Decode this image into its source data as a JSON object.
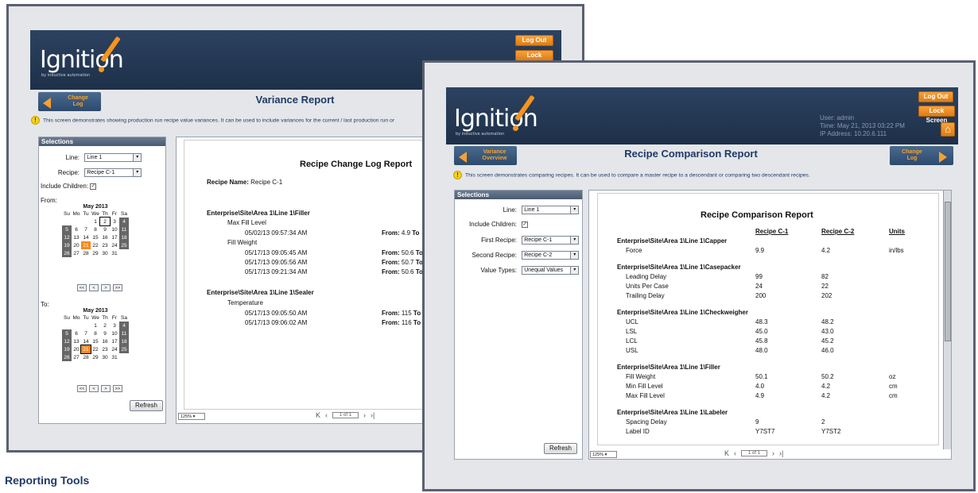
{
  "back": {
    "logo": "Ignition",
    "logo_sub": "by inductive automation",
    "log_out": "Log Out",
    "lock_screen": "Lock Screen",
    "nav_left": [
      "Change",
      "Log"
    ],
    "title": "Variance Report",
    "note": "This screen demonstrates showing production run recipe value variances. It can be used to include variances for the current / last production run or",
    "selections": "Selections",
    "line_label": "Line:",
    "line_value": "Line 1",
    "recipe_label": "Recipe:",
    "recipe_value": "Recipe C-1",
    "include_children": "Include Children:",
    "from_label": "From:",
    "to_label": "To:",
    "month": "May 2013",
    "weekdays": [
      "Su",
      "Mo",
      "Tu",
      "We",
      "Th",
      "Fr",
      "Sa"
    ],
    "refresh": "Refresh",
    "report_title": "Recipe Change Log Report",
    "recipe_name_label": "Recipe Name:",
    "recipe_name_value": "Recipe C-1",
    "group1": "Enterprise\\Site\\Area 1\\Line 1\\Filler",
    "max_fill": "Max Fill Level",
    "t1": "05/02/13 09:57:34 AM",
    "f1": "4.9",
    "fill_weight": "Fill Weight",
    "t2": "05/17/13 09:05:45 AM",
    "f2": "50.6",
    "t3": "05/17/13 09:05:56 AM",
    "f3": "50.7",
    "t4": "05/17/13 09:21:34 AM",
    "f4": "50.6",
    "group2": "Enterprise\\Site\\Area 1\\Line 1\\Sealer",
    "temperature": "Temperature",
    "t5": "05/17/13 09:05:50 AM",
    "f5": "115",
    "t6": "05/17/13 09:06:02 AM",
    "f6": "116",
    "from_word": "From:",
    "to_word": "To",
    "zoom": "125%",
    "page": "1 of 1"
  },
  "front": {
    "logo": "Ignition",
    "logo_sub": "by inductive automation",
    "log_out": "Log Out",
    "lock_screen": "Lock Screen",
    "user": "User: admin",
    "time": "Time: May 21, 2013 03:22 PM",
    "ip": "IP Address: 10.20.6.111",
    "home_icon": "home-icon",
    "nav_left": [
      "Variance",
      "Overview"
    ],
    "nav_right": [
      "Change",
      "Log"
    ],
    "title": "Recipe Comparison Report",
    "note": "This screen demonstrates comparing recipes. It can be used to compare a master recipe to a descendant or comparing two descendant recipes.",
    "selections": "Selections",
    "line_label": "Line:",
    "line_value": "Line 1",
    "include_children": "Include Children:",
    "first_recipe_label": "First Recipe:",
    "first_recipe_value": "Recipe C-1",
    "second_recipe_label": "Second Recipe:",
    "second_recipe_value": "Recipe C-2",
    "value_types_label": "Value Types:",
    "value_types_value": "Unequal Values",
    "refresh": "Refresh",
    "report_title": "Recipe Comparison Report",
    "columns": [
      "Recipe C-1",
      "Recipe C-2",
      "Units"
    ],
    "groups": [
      {
        "name": "Enterprise\\Site\\Area 1\\Line 1\\Capper",
        "rows": [
          [
            "Force",
            "9.9",
            "4.2",
            "in/lbs"
          ]
        ]
      },
      {
        "name": "Enterprise\\Site\\Area 1\\Line 1\\Casepacker",
        "rows": [
          [
            "Leading Delay",
            "99",
            "82",
            ""
          ],
          [
            "Units Per Case",
            "24",
            "22",
            ""
          ],
          [
            "Trailing Delay",
            "200",
            "202",
            ""
          ]
        ]
      },
      {
        "name": "Enterprise\\Site\\Area 1\\Line 1\\Checkweigher",
        "rows": [
          [
            "UCL",
            "48.3",
            "48.2",
            ""
          ],
          [
            "LSL",
            "45.0",
            "43.0",
            ""
          ],
          [
            "LCL",
            "45.8",
            "45.2",
            ""
          ],
          [
            "USL",
            "48.0",
            "46.0",
            ""
          ]
        ]
      },
      {
        "name": "Enterprise\\Site\\Area 1\\Line 1\\Filler",
        "rows": [
          [
            "Fill Weight",
            "50.1",
            "50.2",
            "oz"
          ],
          [
            "Min Fill Level",
            "4.0",
            "4.2",
            "cm"
          ],
          [
            "Max Fill Level",
            "4.9",
            "4.2",
            "cm"
          ]
        ]
      },
      {
        "name": "Enterprise\\Site\\Area 1\\Line 1\\Labeler",
        "rows": [
          [
            "Spacing Delay",
            "9",
            "2",
            ""
          ],
          [
            "Label ID",
            "Y7ST7",
            "Y7ST2",
            ""
          ]
        ]
      }
    ],
    "zoom": "125%",
    "page": "1 of 1"
  },
  "caption": "Reporting Tools"
}
